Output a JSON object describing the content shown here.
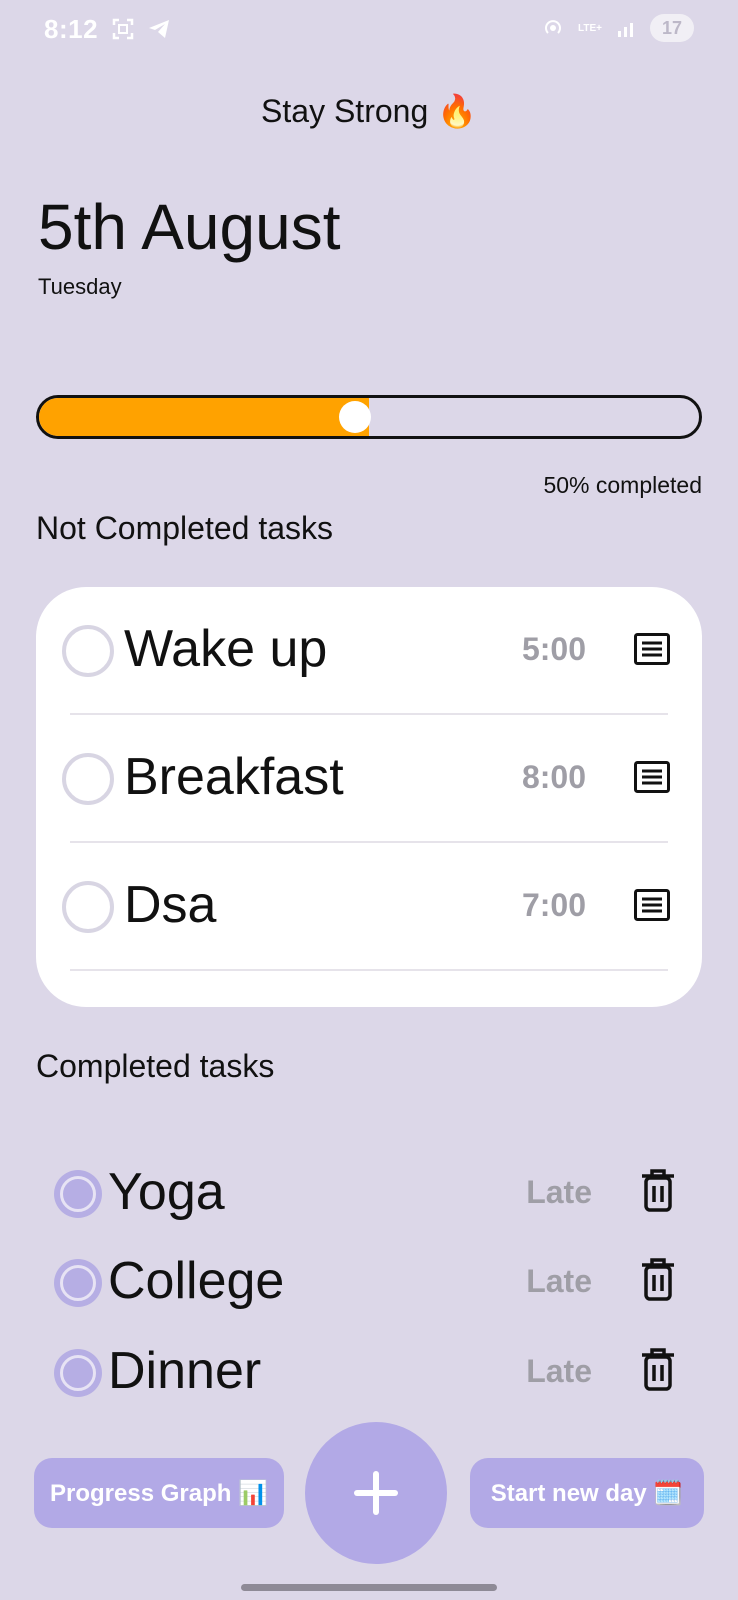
{
  "status_bar": {
    "time": "8:12",
    "network": "LTE+",
    "battery": "17"
  },
  "header": {
    "app_title": "Stay Strong 🔥",
    "date": "5th August",
    "day": "Tuesday"
  },
  "progress": {
    "value_fraction": 0.5,
    "label": "50% completed",
    "fill_color": "#ffa200"
  },
  "not_completed": {
    "title": "Not Completed tasks",
    "tasks": [
      {
        "name": "Wake up",
        "time": "5:00"
      },
      {
        "name": "Breakfast",
        "time": "8:00"
      },
      {
        "name": "Dsa",
        "time": "7:00"
      }
    ]
  },
  "completed": {
    "title": "Completed tasks",
    "tasks": [
      {
        "name": "Yoga",
        "status": "Late"
      },
      {
        "name": "College",
        "status": "Late"
      },
      {
        "name": "Dinner",
        "status": "Late"
      }
    ]
  },
  "buttons": {
    "progress_graph": "Progress Graph 📊",
    "add": "+",
    "start_new_day": "Start new day 🗓️"
  },
  "colors": {
    "background": "#dcd7e8",
    "accent": "#b2a9e6",
    "progress": "#ffa200"
  }
}
